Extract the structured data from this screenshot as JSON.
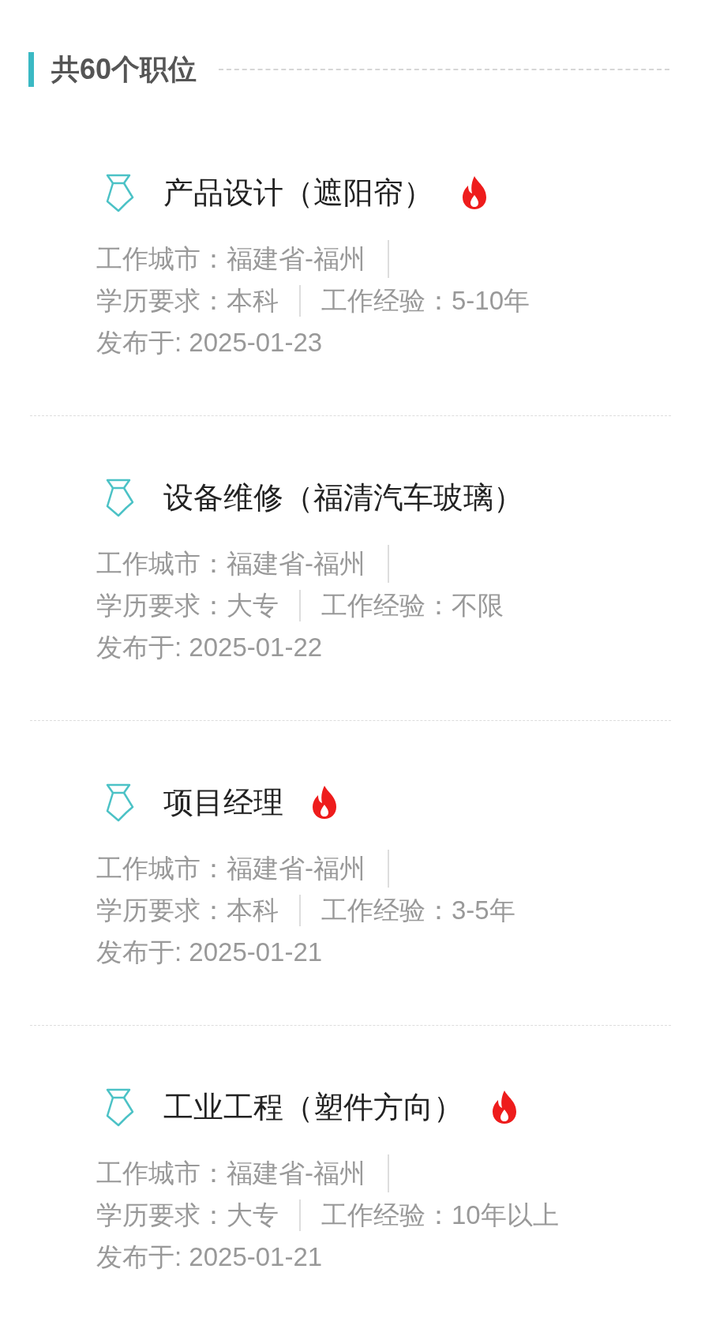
{
  "header": {
    "title": "共60个职位"
  },
  "jobs": [
    {
      "title": "产品设计（遮阳帘）",
      "hot": true,
      "city": "工作城市：福建省-福州",
      "education": "学历要求：本科",
      "experience": "工作经验：5-10年",
      "posted": "发布于: 2025-01-23"
    },
    {
      "title": "设备维修（福清汽车玻璃）",
      "hot": false,
      "city": "工作城市：福建省-福州",
      "education": "学历要求：大专",
      "experience": "工作经验：不限",
      "posted": "发布于: 2025-01-22"
    },
    {
      "title": "项目经理",
      "hot": true,
      "city": "工作城市：福建省-福州",
      "education": "学历要求：本科",
      "experience": "工作经验：3-5年",
      "posted": "发布于: 2025-01-21"
    },
    {
      "title": "工业工程（塑件方向）",
      "hot": true,
      "city": "工作城市：福建省-福州",
      "education": "学历要求：大专",
      "experience": "工作经验：10年以上",
      "posted": "发布于: 2025-01-21"
    }
  ]
}
